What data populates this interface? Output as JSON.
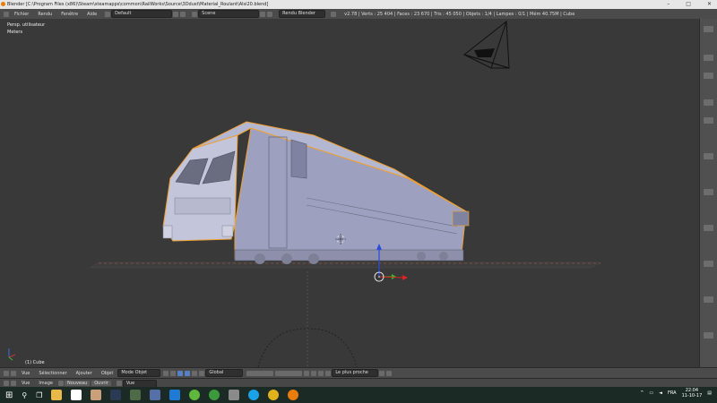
{
  "window": {
    "title": "Blender [C:\\Program Files (x86)\\Steam\\steamapps\\common\\RailWorks\\Source\\3Ddust\\Material_Roulant\\Alsi20.blend]"
  },
  "info_header": {
    "menu": [
      "Fichier",
      "Rendu",
      "Fenêtre",
      "Aide"
    ],
    "screen_layout": "Default",
    "scene": "Scene",
    "render_engine": "Rendu Blender",
    "stats": "v2.78 | Verts : 25 404 | Faces : 23 670 | Tris : 45 050 | Objets : 1/4 | Lampes : 0/1 | Mém 40.75M | Cube"
  },
  "viewport": {
    "view_name": "Persp. utilisateur",
    "units": "Meters",
    "object_label": "(1) Cube"
  },
  "view3d_header": {
    "menu": [
      "Vue",
      "Sélectionner",
      "Ajouter",
      "Objet"
    ],
    "mode": "Mode Objet",
    "orientation": "Global",
    "snap_target": "Le plus proche"
  },
  "image_header": {
    "menu": [
      "Vue",
      "Image"
    ],
    "new_label": "Nouveau",
    "open_label": "Ouvrir",
    "view_label": "Vue"
  },
  "taskbar": {
    "language": "FRA",
    "time": "22:04",
    "date": "11-10-17"
  },
  "colors": {
    "accent": "#e87d0d",
    "selection_outline": "#f0a030",
    "model": "#9da0bf"
  }
}
